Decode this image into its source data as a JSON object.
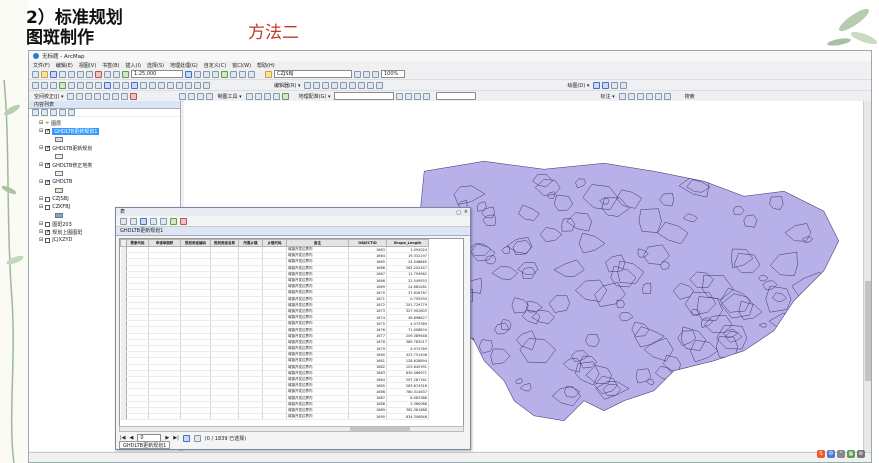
{
  "slide": {
    "title_line1": "2）标准规划",
    "title_line2": "图斑制作",
    "subtitle": "方法二"
  },
  "app": {
    "title": "无标题 - ArcMap",
    "menu": [
      "文件(F)",
      "编辑(E)",
      "视图(V)",
      "书签(B)",
      "插入(I)",
      "选择(S)",
      "地理处理(G)",
      "自定义(C)",
      "窗口(W)",
      "帮助(H)"
    ],
    "scale": "1:25,000",
    "layer_select": "CZJSBJ",
    "zoom_pct": "100%",
    "toolbar_labels": {
      "georef": "空间校正(J) ▾",
      "drawing": "绘图(D) ▾",
      "editor": "编辑器(R) ▾",
      "layout": "制图工具 ▾",
      "geo_db": "地理配准(G) ▾",
      "label": "标注 ▾",
      "search": "搜索"
    }
  },
  "toc": {
    "title": "内容列表",
    "root": "图层",
    "layers": [
      {
        "name": "GHDLTB更新规划1",
        "checked": true,
        "selected": true,
        "swatch": "#cfe0f5"
      },
      {
        "name": "GHDLTB更新规划",
        "checked": true,
        "selected": false,
        "swatch": "#f5f0d8"
      },
      {
        "name": "GHDLTB修正地类",
        "checked": true,
        "selected": false,
        "swatch": "#e8f5e0"
      },
      {
        "name": "GHDLTB",
        "checked": true,
        "selected": false,
        "swatch": "#d8f0d0"
      },
      {
        "name": "CZJSBJ",
        "checked": false,
        "selected": false,
        "swatch": null
      },
      {
        "name": "CZKFBJ",
        "checked": false,
        "selected": false,
        "swatch": "#7aa7e8"
      },
      {
        "name": "图斑203",
        "checked": false,
        "selected": false,
        "swatch": null
      },
      {
        "name": "规划上图图斑",
        "checked": true,
        "selected": false,
        "swatch": null
      },
      {
        "name": "JCJXZYD",
        "checked": false,
        "selected": false,
        "swatch": null
      }
    ]
  },
  "table_window": {
    "title": "表",
    "layer_tab": "GHDLTB更新规划1",
    "columns": [
      "要素代码",
      "申请单面积",
      "规划用途编码",
      "规划用途名称",
      "所属乡镇",
      "乡镇代码",
      "备注",
      "OBJECTID",
      "Shape_Length"
    ],
    "rows": [
      [
        "",
        "",
        "",
        "",
        "",
        "",
        "城镇开发边界内",
        "1663",
        "1.094024"
      ],
      [
        "",
        "",
        "",
        "",
        "",
        "",
        "城镇开发边界内",
        "1664",
        "19.332197"
      ],
      [
        "",
        "",
        "",
        "",
        "",
        "",
        "城镇开发边界内",
        "1665",
        "24.548865"
      ],
      [
        "",
        "",
        "",
        "",
        "",
        "",
        "城镇开发边界内",
        "1666",
        "263.202447"
      ],
      [
        "",
        "",
        "",
        "",
        "",
        "",
        "城镇开发边界内",
        "1667",
        "11.794982"
      ],
      [
        "",
        "",
        "",
        "",
        "",
        "",
        "城镇开发边界内",
        "1668",
        "22.549553"
      ],
      [
        "",
        "",
        "",
        "",
        "",
        "",
        "城镇开发边界内",
        "1669",
        "24.682081"
      ],
      [
        "",
        "",
        "",
        "",
        "",
        "",
        "城镇开发边界内",
        "1670",
        "37.828787"
      ],
      [
        "",
        "",
        "",
        "",
        "",
        "",
        "城镇开发边界内",
        "1671",
        "0.759294"
      ],
      [
        "",
        "",
        "",
        "",
        "",
        "",
        "城镇开发边界内",
        "1672",
        "201.729779"
      ],
      [
        "",
        "",
        "",
        "",
        "",
        "",
        "城镇开发边界内",
        "1673",
        "327.902803"
      ],
      [
        "",
        "",
        "",
        "",
        "",
        "",
        "城镇开发边界内",
        "1674",
        "46.898827"
      ],
      [
        "",
        "",
        "",
        "",
        "",
        "",
        "城镇开发边界内",
        "1675",
        "4.070389"
      ],
      [
        "",
        "",
        "",
        "",
        "",
        "",
        "城镇开发边界内",
        "1676",
        "71.008834"
      ],
      [
        "",
        "",
        "",
        "",
        "",
        "",
        "城镇开发边界内",
        "1677",
        "209.089648"
      ],
      [
        "",
        "",
        "",
        "",
        "",
        "",
        "城镇开发边界内",
        "1678",
        "389.783017"
      ],
      [
        "",
        "",
        "",
        "",
        "",
        "",
        "城镇开发边界内",
        "1679",
        "4.974789"
      ],
      [
        "",
        "",
        "",
        "",
        "",
        "",
        "城镇开发边界内",
        "1680",
        "423.751408"
      ],
      [
        "",
        "",
        "",
        "",
        "",
        "",
        "城镇开发边界内",
        "1681",
        "128.628894"
      ],
      [
        "",
        "",
        "",
        "",
        "",
        "",
        "城镇开发边界内",
        "1682",
        "103.640391"
      ],
      [
        "",
        "",
        "",
        "",
        "",
        "",
        "城镇开发边界内",
        "1683",
        "630.466971"
      ],
      [
        "",
        "",
        "",
        "",
        "",
        "",
        "城镇开发边界内",
        "1684",
        "297.287161"
      ],
      [
        "",
        "",
        "",
        "",
        "",
        "",
        "城镇开发边界内",
        "1685",
        "263.674316"
      ],
      [
        "",
        "",
        "",
        "",
        "",
        "",
        "城镇开发边界内",
        "1686",
        "780.314637"
      ],
      [
        "",
        "",
        "",
        "",
        "",
        "",
        "城镇开发边界内",
        "1687",
        "8.083388"
      ],
      [
        "",
        "",
        "",
        "",
        "",
        "",
        "城镇开发边界内",
        "1688",
        "3.360088"
      ],
      [
        "",
        "",
        "",
        "",
        "",
        "",
        "城镇开发边界内",
        "1689",
        "362.361888"
      ],
      [
        "",
        "",
        "",
        "",
        "",
        "",
        "城镇开发边界内",
        "1690",
        "834.306846"
      ]
    ],
    "record_nav": {
      "current": "0",
      "status": "(0 / 1839 已选择)"
    }
  },
  "colors": {
    "polygon_fill": "#b8b0e8",
    "polygon_stroke": "#3a3466",
    "title_red": "#c0392b"
  }
}
